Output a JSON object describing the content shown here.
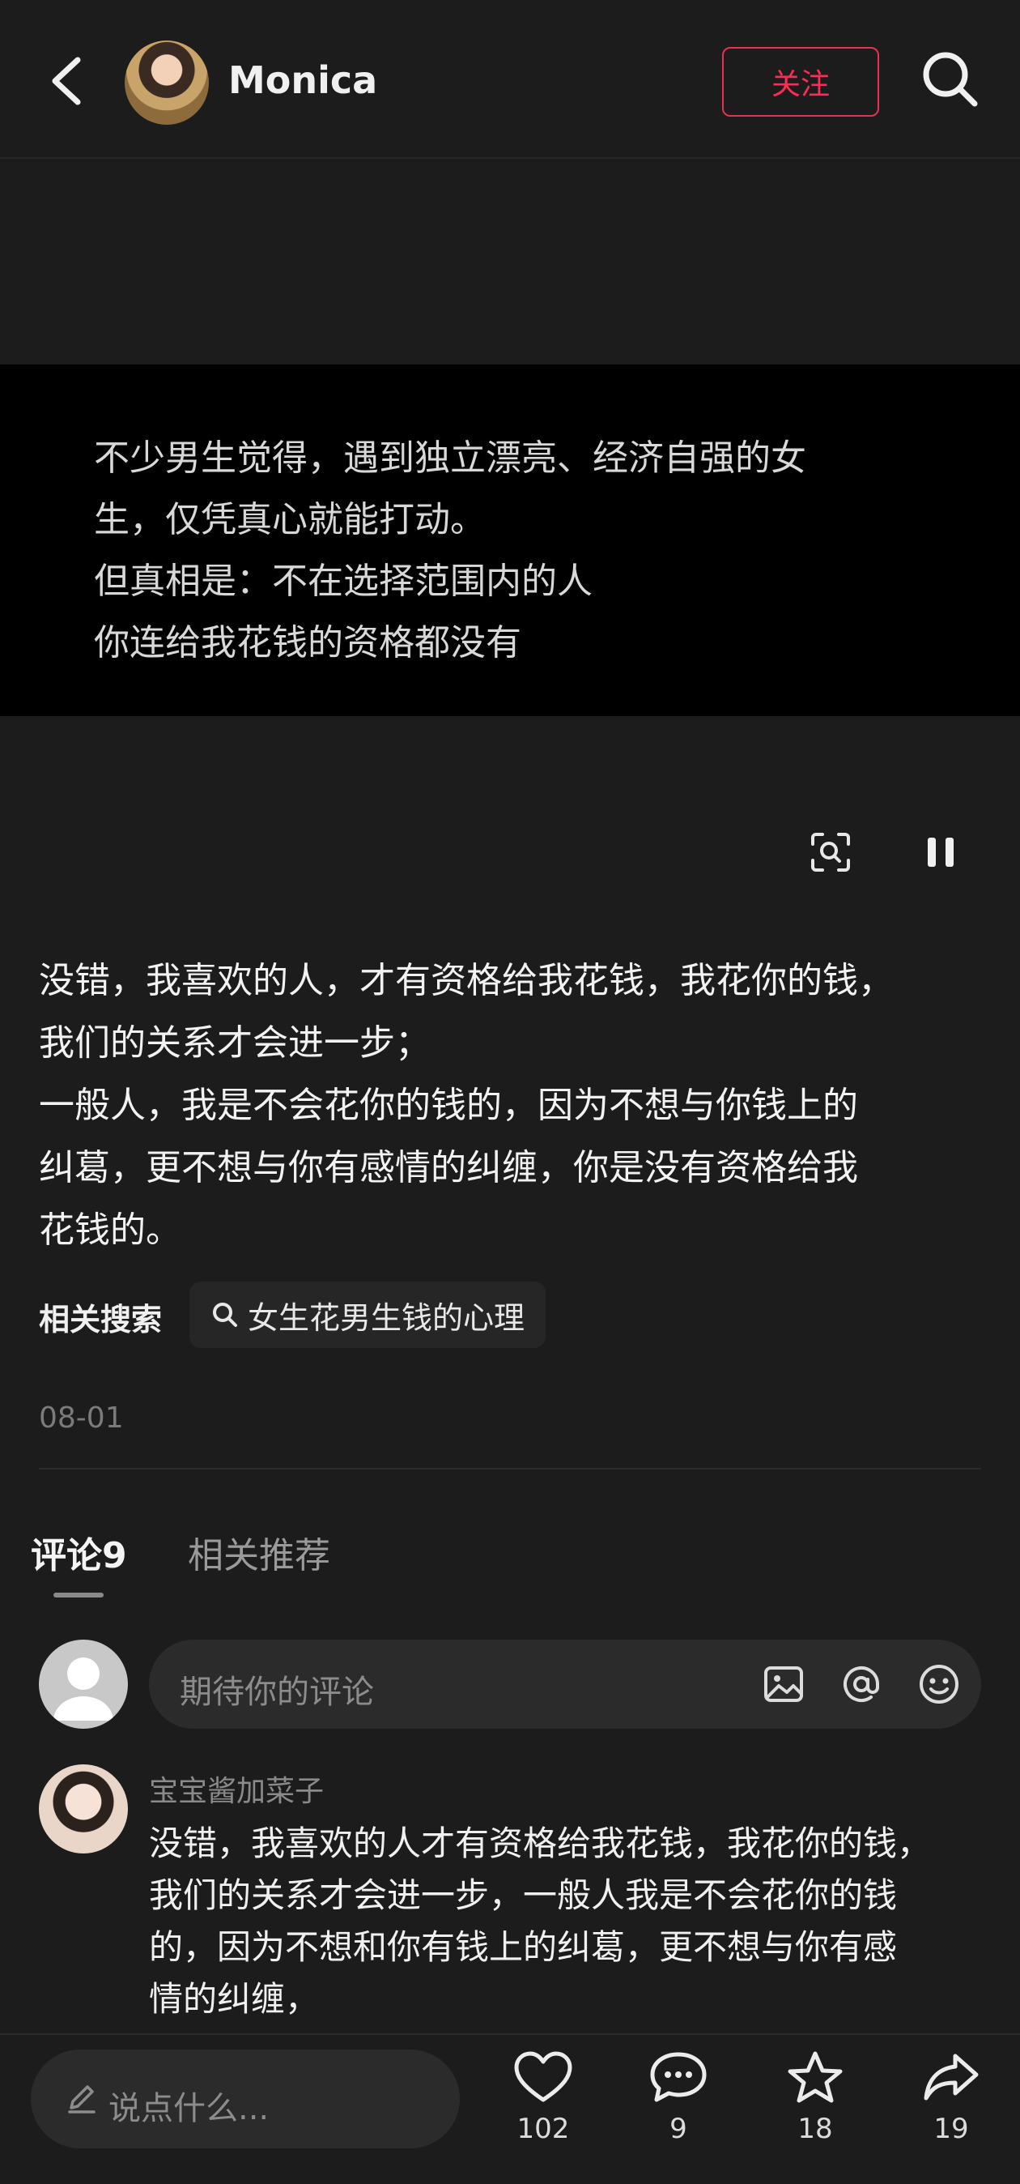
{
  "header": {
    "username": "Monica",
    "follow_label": "关注"
  },
  "video": {
    "lines": [
      "不少男生觉得，遇到独立漂亮、经济自强的女",
      "生，仅凭真心就能打动。",
      "但真相是：不在选择范围内的人",
      "你连给我花钱的资格都没有"
    ]
  },
  "caption": {
    "lines": [
      "没错，我喜欢的人，才有资格给我花钱，我花你的钱，",
      "我们的关系才会进一步；",
      "一般人，我是不会花你的钱的，因为不想与你钱上的",
      "纠葛，更不想与你有感情的纠缠，你是没有资格给我",
      "花钱的。"
    ]
  },
  "related": {
    "label": "相关搜索",
    "query": "女生花男生钱的心理"
  },
  "date": "08-01",
  "tabs": {
    "comments": "评论9",
    "recommend": "相关推荐"
  },
  "comment_input": {
    "placeholder": "期待你的评论"
  },
  "comment": {
    "user": "宝宝酱加菜子",
    "lines": [
      "没错，我喜欢的人才有资格给我花钱，我花你的钱，",
      "我们的关系才会进一步，一般人我是不会花你的钱",
      "的，因为不想和你有钱上的纠葛，更不想与你有感",
      "情的纠缠，"
    ]
  },
  "bottom": {
    "say_placeholder": "说点什么...",
    "likes": "102",
    "comments": "9",
    "favorites": "18",
    "shares": "19"
  },
  "colors": {
    "accent": "#fe2c55",
    "background": "#1c1c1c"
  }
}
